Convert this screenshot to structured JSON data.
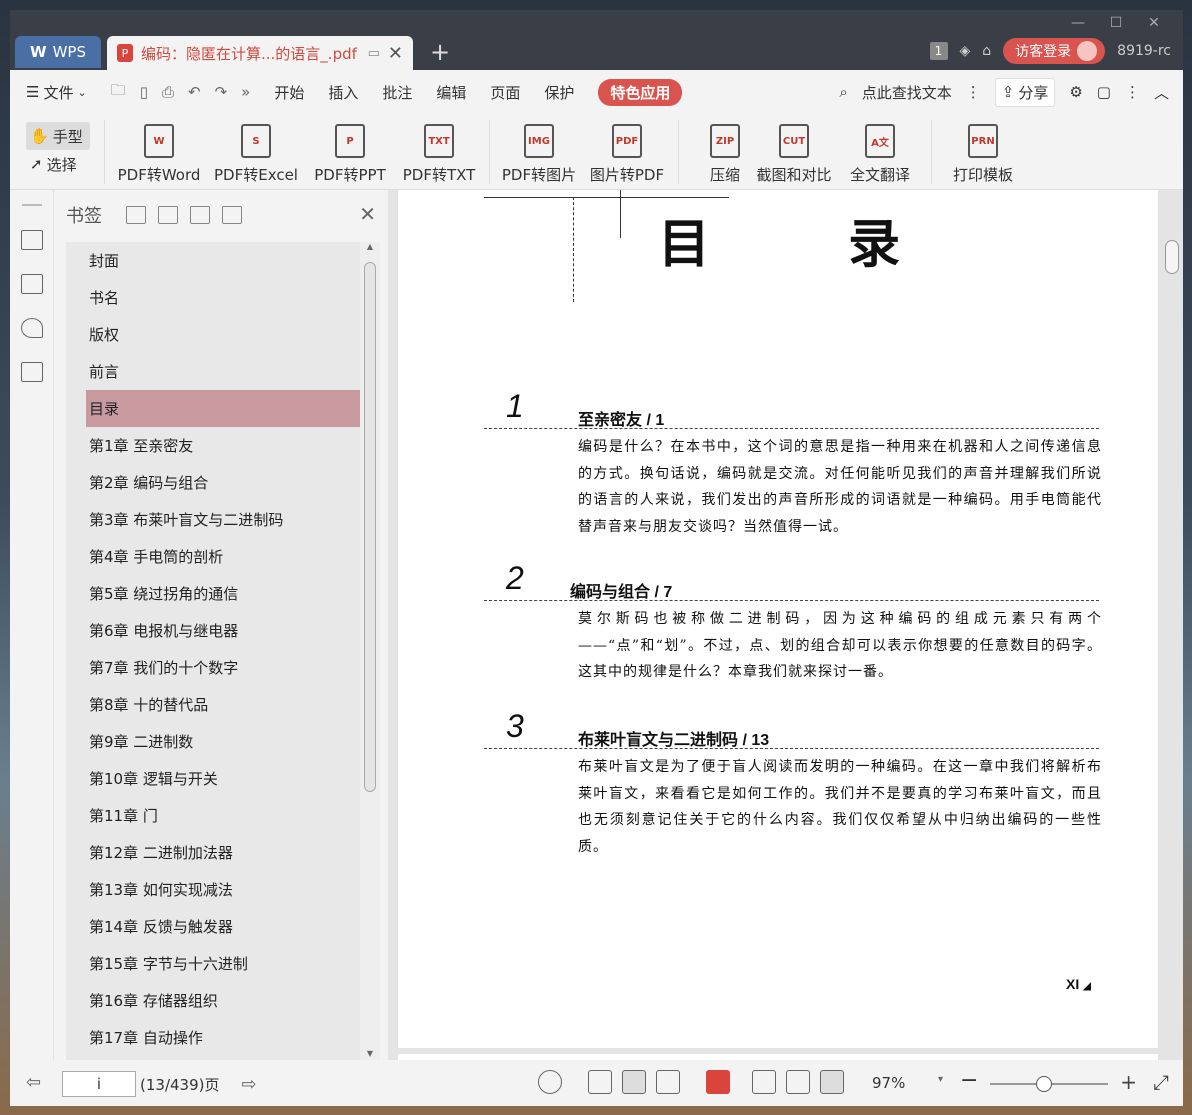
{
  "titlebar": {
    "app_tab": "WPS",
    "doc_tab_title": "编码：隐匿在计算...的语言_.pdf",
    "page_badge": "1",
    "login_label": "访客登录",
    "user_id": "8919-rc"
  },
  "menubar": {
    "file_label": "文件",
    "items": [
      "开始",
      "插入",
      "批注",
      "编辑",
      "页面",
      "保护",
      "特色应用"
    ],
    "search_label": "点此查找文本",
    "share_label": "分享"
  },
  "ribbon": {
    "hand_label": "手型",
    "select_label": "选择",
    "buttons": [
      {
        "label": "PDF转Word",
        "icon": "W"
      },
      {
        "label": "PDF转Excel",
        "icon": "S"
      },
      {
        "label": "PDF转PPT",
        "icon": "P"
      },
      {
        "label": "PDF转TXT",
        "icon": "TXT"
      },
      {
        "label": "PDF转图片",
        "icon": "IMG"
      },
      {
        "label": "图片转PDF",
        "icon": "PDF"
      },
      {
        "label": "压缩",
        "icon": "ZIP"
      },
      {
        "label": "截图和对比",
        "icon": "CUT"
      },
      {
        "label": "全文翻译",
        "icon": "A文"
      },
      {
        "label": "打印模板",
        "icon": "PRN"
      }
    ]
  },
  "bookmarks": {
    "title": "书签",
    "items": [
      "封面",
      "书名",
      "版权",
      "前言",
      "目录",
      "第1章 至亲密友",
      "第2章 编码与组合",
      "第3章 布莱叶盲文与二进制码",
      "第4章 手电筒的剖析",
      "第5章 绕过拐角的通信",
      "第6章 电报机与继电器",
      "第7章 我们的十个数字",
      "第8章 十的替代品",
      "第9章 二进制数",
      "第10章 逻辑与开关",
      "第11章 门",
      "第12章 二进制加法器",
      "第13章 如何实现减法",
      "第14章 反馈与触发器",
      "第15章 字节与十六进制",
      "第16章 存储器组织",
      "第17章 自动操作"
    ],
    "selected_index": 4
  },
  "document": {
    "page_title": "目 录",
    "chapters": [
      {
        "num": "1",
        "heading": "至亲密友 / 1",
        "body": "编码是什么？在本书中，这个词的意思是指一种用来在机器和人之间传递信息的方式。换句话说，编码就是交流。对任何能听见我们的声音并理解我们所说的语言的人来说，我们发出的声音所形成的词语就是一种编码。用手电筒能代替声音来与朋友交谈吗？当然值得一试。"
      },
      {
        "num": "2",
        "heading": "编码与组合 / 7",
        "body": "莫尔斯码也被称做二进制码，因为这种编码的组成元素只有两个——“点”和“划”。不过，点、划的组合却可以表示你想要的任意数目的码字。这其中的规律是什么？本章我们就来探讨一番。"
      },
      {
        "num": "3",
        "heading": "布莱叶盲文与二进制码 / 13",
        "body": "布莱叶盲文是为了便于盲人阅读而发明的一种编码。在这一章中我们将解析布莱叶盲文，来看看它是如何工作的。我们并不是要真的学习布莱叶盲文，而且也无须刻意记住关于它的什么内容。我们仅仅希望从中归纳出编码的一些性质。"
      }
    ],
    "page_number": "XI"
  },
  "statusbar": {
    "page_input": "i",
    "page_count": "(13/439)页",
    "zoom": "97%"
  }
}
